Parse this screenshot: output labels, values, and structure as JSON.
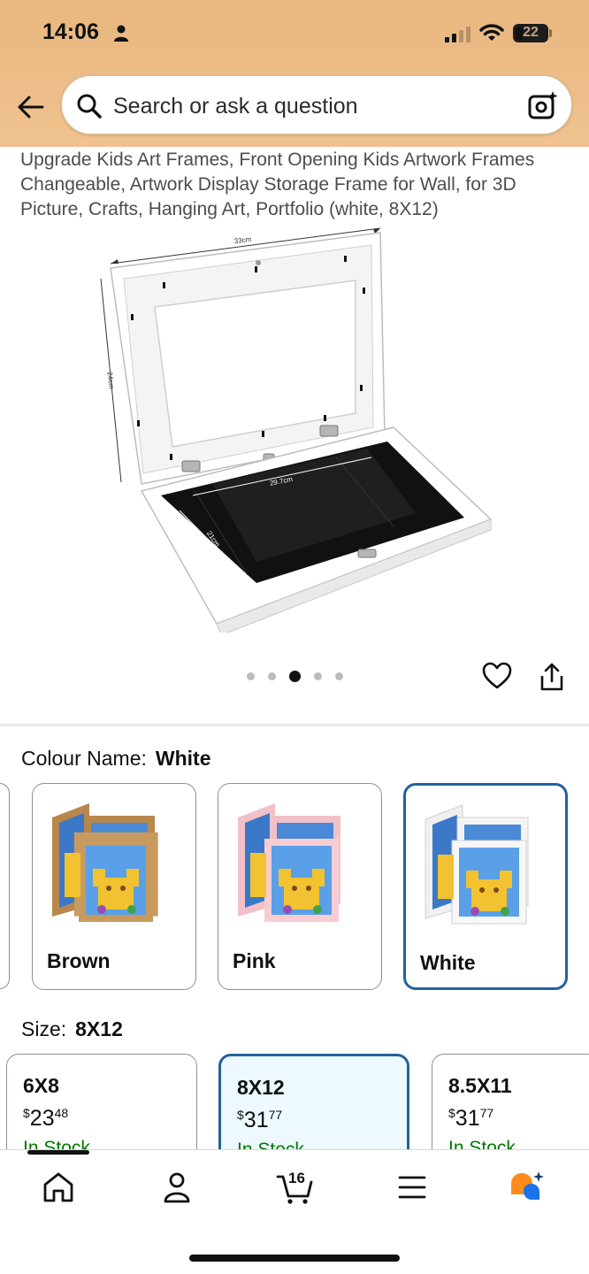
{
  "status_bar": {
    "time": "14:06",
    "battery": "22"
  },
  "search": {
    "placeholder": "Search or ask a question"
  },
  "product": {
    "title": "Upgrade Kids Art Frames, Front Opening Kids Artwork Frames Changeable, Artwork Display Storage Frame for Wall, for 3D Picture, Crafts, Hanging Art, Portfolio (white, 8X12)",
    "image_labels": {
      "width": "33cm",
      "height": "24cm",
      "inner_width": "29.7cm",
      "inner_height": "21cm"
    }
  },
  "carousel": {
    "count": 5,
    "active_index": 2
  },
  "colour": {
    "label": "Colour Name:",
    "selected": "White",
    "options": [
      {
        "name": "Brown",
        "frame_color": "#b8874d"
      },
      {
        "name": "Pink",
        "frame_color": "#f2c1c8"
      },
      {
        "name": "White",
        "frame_color": "#f2f2f2"
      }
    ]
  },
  "size": {
    "label": "Size:",
    "selected": "8X12",
    "options": [
      {
        "name": "6X8",
        "currency": "$",
        "whole": "23",
        "cents": "48",
        "stock": "In Stock"
      },
      {
        "name": "8X12",
        "currency": "$",
        "whole": "31",
        "cents": "77",
        "stock": "In Stock"
      },
      {
        "name": "8.5X11",
        "currency": "$",
        "whole": "31",
        "cents": "77",
        "stock": "In Stock"
      }
    ]
  },
  "bottom_nav": {
    "items": [
      "home-icon",
      "account-icon",
      "cart-icon",
      "menu-icon",
      "rufus-icon"
    ],
    "cart_count": "16"
  },
  "colors": {
    "header": "#efc28f",
    "selected_border": "#2162a1",
    "in_stock": "#007600",
    "rufus_orange": "#ff8c1a",
    "rufus_blue": "#1a73e8"
  }
}
